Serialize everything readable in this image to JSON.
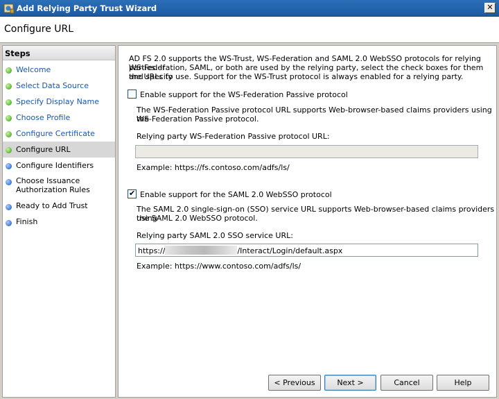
{
  "window": {
    "title": "Add Relying Party Trust Wizard",
    "close_glyph": "✕"
  },
  "header": {
    "title": "Configure URL"
  },
  "sidebar": {
    "heading": "Steps",
    "items": [
      {
        "label": "Welcome",
        "state": "done"
      },
      {
        "label": "Select Data Source",
        "state": "done"
      },
      {
        "label": "Specify Display Name",
        "state": "done"
      },
      {
        "label": "Choose Profile",
        "state": "done"
      },
      {
        "label": "Configure Certificate",
        "state": "done"
      },
      {
        "label": "Configure URL",
        "state": "current"
      },
      {
        "label": "Configure Identifiers",
        "state": "pending"
      },
      {
        "label": "Choose Issuance Authorization Rules",
        "label_lines": [
          "Choose Issuance",
          "Authorization Rules"
        ],
        "state": "pending"
      },
      {
        "label": "Ready to Add Trust",
        "state": "pending"
      },
      {
        "label": "Finish",
        "state": "pending"
      }
    ]
  },
  "main": {
    "intro": [
      "AD FS 2.0 supports the WS-Trust, WS-Federation and SAML 2.0 WebSSO protocols for relying parties.  If",
      "WS-Federation, SAML, or both are used by the relying party, select the check boxes for them and specify",
      "the URLs to use.  Support for the WS-Trust protocol is always enabled for a relying party."
    ],
    "wsfed": {
      "checkbox_label": "Enable support for the WS-Federation Passive protocol",
      "checked": false,
      "description": [
        "The WS-Federation Passive protocol URL supports Web-browser-based claims providers using the",
        "WS-Federation Passive protocol."
      ],
      "field_label": "Relying party WS-Federation Passive protocol URL:",
      "value": "",
      "example": "Example: https://fs.contoso.com/adfs/ls/"
    },
    "saml": {
      "checkbox_label": "Enable support for the SAML 2.0 WebSSO protocol",
      "checked": true,
      "description": [
        "The SAML 2.0 single-sign-on (SSO) service URL supports Web-browser-based claims providers using",
        "the SAML 2.0 WebSSO protocol."
      ],
      "field_label": "Relying party SAML 2.0 SSO service URL:",
      "value_prefix": "https://",
      "value_suffix": "/Interact/Login/default.aspx",
      "example": "Example: https://www.contoso.com/adfs/ls/"
    }
  },
  "buttons": {
    "previous": "< Previous",
    "next": "Next >",
    "cancel": "Cancel",
    "help": "Help"
  },
  "colors": {
    "title_bar": "#1d5aa0",
    "done_step_text": "#1a56b0",
    "done_dot": "#2f9a16",
    "pending_dot": "#1850c0",
    "selected_step_bg": "#d7d7d7"
  }
}
